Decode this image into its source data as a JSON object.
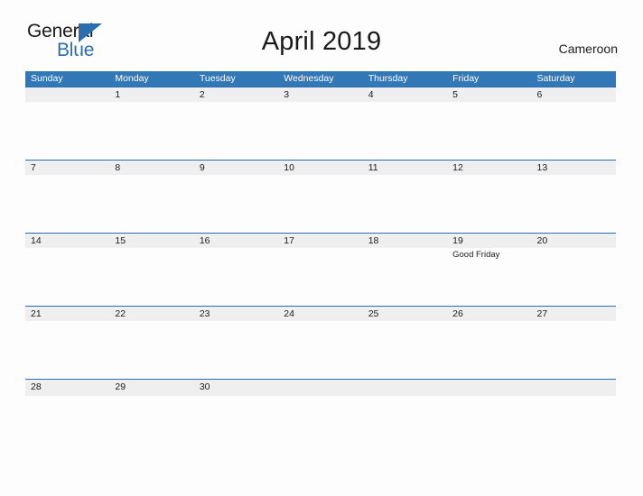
{
  "brand": {
    "line1": "General",
    "line2": "Blue",
    "triangle_icon": "triangle-icon",
    "accent_color": "#2a6db0"
  },
  "header": {
    "title": "April 2019",
    "region": "Cameroon"
  },
  "colors": {
    "header_blue": "#3277b6",
    "row_border_blue": "#2a6db0",
    "date_band_gray": "#efefef",
    "page_background": "#fdfdfd",
    "text": "#1a1a1a"
  },
  "calendar": {
    "month": "April",
    "year": "2019",
    "weekday_headers": [
      "Sunday",
      "Monday",
      "Tuesday",
      "Wednesday",
      "Thursday",
      "Friday",
      "Saturday"
    ],
    "weeks": [
      [
        {
          "day": "",
          "event": ""
        },
        {
          "day": "1",
          "event": ""
        },
        {
          "day": "2",
          "event": ""
        },
        {
          "day": "3",
          "event": ""
        },
        {
          "day": "4",
          "event": ""
        },
        {
          "day": "5",
          "event": ""
        },
        {
          "day": "6",
          "event": ""
        }
      ],
      [
        {
          "day": "7",
          "event": ""
        },
        {
          "day": "8",
          "event": ""
        },
        {
          "day": "9",
          "event": ""
        },
        {
          "day": "10",
          "event": ""
        },
        {
          "day": "11",
          "event": ""
        },
        {
          "day": "12",
          "event": ""
        },
        {
          "day": "13",
          "event": ""
        }
      ],
      [
        {
          "day": "14",
          "event": ""
        },
        {
          "day": "15",
          "event": ""
        },
        {
          "day": "16",
          "event": ""
        },
        {
          "day": "17",
          "event": ""
        },
        {
          "day": "18",
          "event": ""
        },
        {
          "day": "19",
          "event": "Good Friday"
        },
        {
          "day": "20",
          "event": ""
        }
      ],
      [
        {
          "day": "21",
          "event": ""
        },
        {
          "day": "22",
          "event": ""
        },
        {
          "day": "23",
          "event": ""
        },
        {
          "day": "24",
          "event": ""
        },
        {
          "day": "25",
          "event": ""
        },
        {
          "day": "26",
          "event": ""
        },
        {
          "day": "27",
          "event": ""
        }
      ],
      [
        {
          "day": "28",
          "event": ""
        },
        {
          "day": "29",
          "event": ""
        },
        {
          "day": "30",
          "event": ""
        },
        {
          "day": "",
          "event": ""
        },
        {
          "day": "",
          "event": ""
        },
        {
          "day": "",
          "event": ""
        },
        {
          "day": "",
          "event": ""
        }
      ]
    ]
  }
}
